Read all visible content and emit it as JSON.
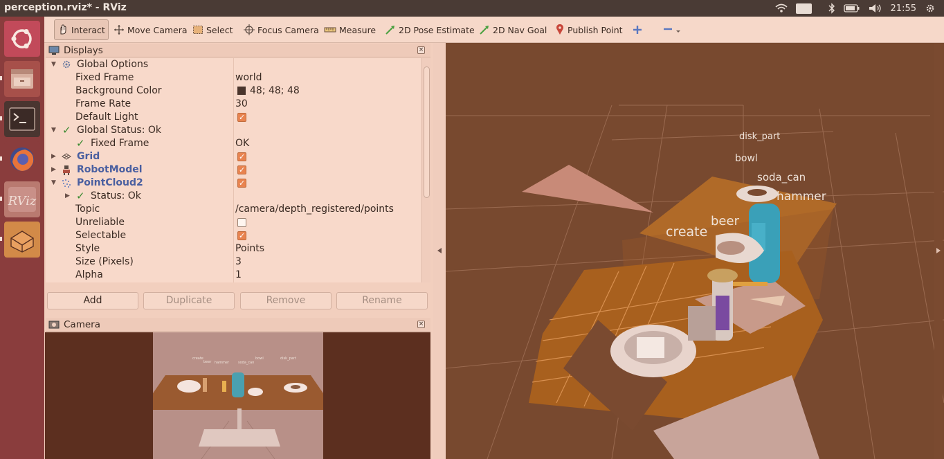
{
  "window": {
    "title": "perception.rviz* - RViz"
  },
  "tray": {
    "keyboard": "En",
    "time": "21:55"
  },
  "launcher": {
    "items": [
      "ubuntu-logo-icon",
      "files-icon",
      "terminal-icon",
      "firefox-icon",
      "rviz-icon",
      "box-app-icon"
    ],
    "rviz_label": "RViz"
  },
  "toolbar": {
    "interact": "Interact",
    "move_camera": "Move Camera",
    "select": "Select",
    "focus_camera": "Focus Camera",
    "measure": "Measure",
    "pose_estimate": "2D Pose Estimate",
    "nav_goal": "2D Nav Goal",
    "publish_point": "Publish Point"
  },
  "displays": {
    "title": "Displays",
    "rows": [
      {
        "label": "Global Options",
        "value": ""
      },
      {
        "label": "Fixed Frame",
        "value": "world"
      },
      {
        "label": "Background Color",
        "value": "48; 48; 48"
      },
      {
        "label": "Frame Rate",
        "value": "30"
      },
      {
        "label": "Default Light",
        "value": ""
      },
      {
        "label": "Global Status: Ok",
        "value": ""
      },
      {
        "label": "Fixed Frame",
        "value": "OK"
      },
      {
        "label": "Grid",
        "value": ""
      },
      {
        "label": "RobotModel",
        "value": ""
      },
      {
        "label": "PointCloud2",
        "value": ""
      },
      {
        "label": "Status: Ok",
        "value": ""
      },
      {
        "label": "Topic",
        "value": "/camera/depth_registered/points"
      },
      {
        "label": "Unreliable",
        "value": ""
      },
      {
        "label": "Selectable",
        "value": ""
      },
      {
        "label": "Style",
        "value": "Points"
      },
      {
        "label": "Size (Pixels)",
        "value": "3"
      },
      {
        "label": "Alpha",
        "value": "1"
      }
    ],
    "checkboxes": {
      "default_light": true,
      "grid": true,
      "robot_model": true,
      "point_cloud2": true,
      "unreliable": false,
      "selectable": true
    },
    "buttons": {
      "add": "Add",
      "duplicate": "Duplicate",
      "remove": "Remove",
      "rename": "Rename"
    }
  },
  "camera_panel": {
    "title": "Camera",
    "labels": [
      "create",
      "beer",
      "hammer",
      "soda_can",
      "bowl",
      "disk_part"
    ]
  },
  "scene": {
    "labels": {
      "disk_part": "disk_part",
      "bowl": "bowl",
      "soda_can": "soda_can",
      "hammer": "hammer",
      "create": "create",
      "beer": "beer"
    }
  },
  "colors": {
    "accent": "#e8834f",
    "bg": "#303030",
    "link": "#4a5fa0"
  }
}
